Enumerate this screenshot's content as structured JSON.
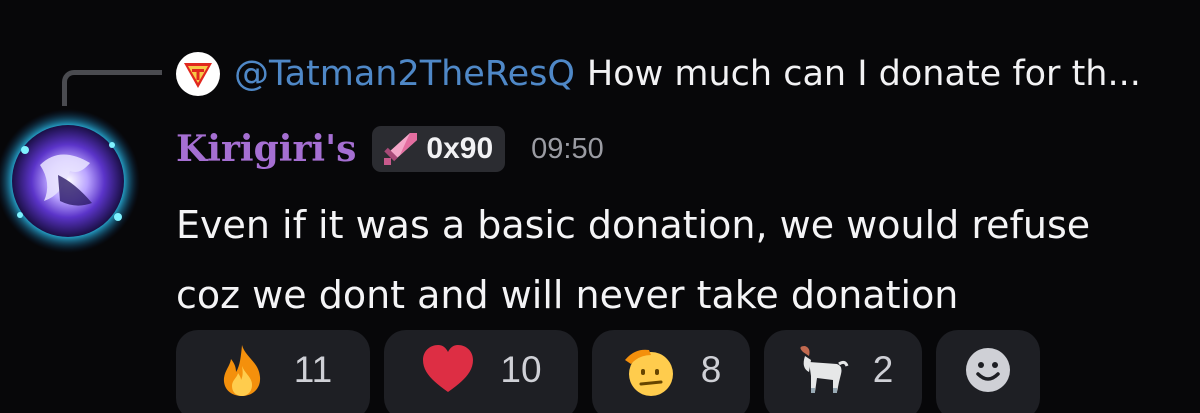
{
  "reply": {
    "author": "@Tatman2TheResQ",
    "preview": "How much can I donate for th...",
    "avatar_icon": "red-triangle-logo-icon"
  },
  "message": {
    "author": "Kirigiri's",
    "role_tag": "0x90",
    "role_icon": "pink-sword-icon",
    "timestamp": "09:50",
    "lines": [
      "Even if it was a basic donation, we would refuse",
      "coz we dont and will never take donation"
    ],
    "author_avatar": "glowing-orb-avatar"
  },
  "reactions": [
    {
      "emoji": "fire-icon",
      "count": "11"
    },
    {
      "emoji": "heart-icon",
      "count": "10"
    },
    {
      "emoji": "saluting-face-icon",
      "count": "8"
    },
    {
      "emoji": "goat-icon",
      "count": "2"
    }
  ],
  "add_reaction_icon": "smiley-add-reaction-icon",
  "colors": {
    "background": "#070709",
    "username": "#a56fd2",
    "mention": "#4f88c7",
    "reaction_bg": "#1e1f24",
    "role_tag_bg": "#2b2c31"
  }
}
